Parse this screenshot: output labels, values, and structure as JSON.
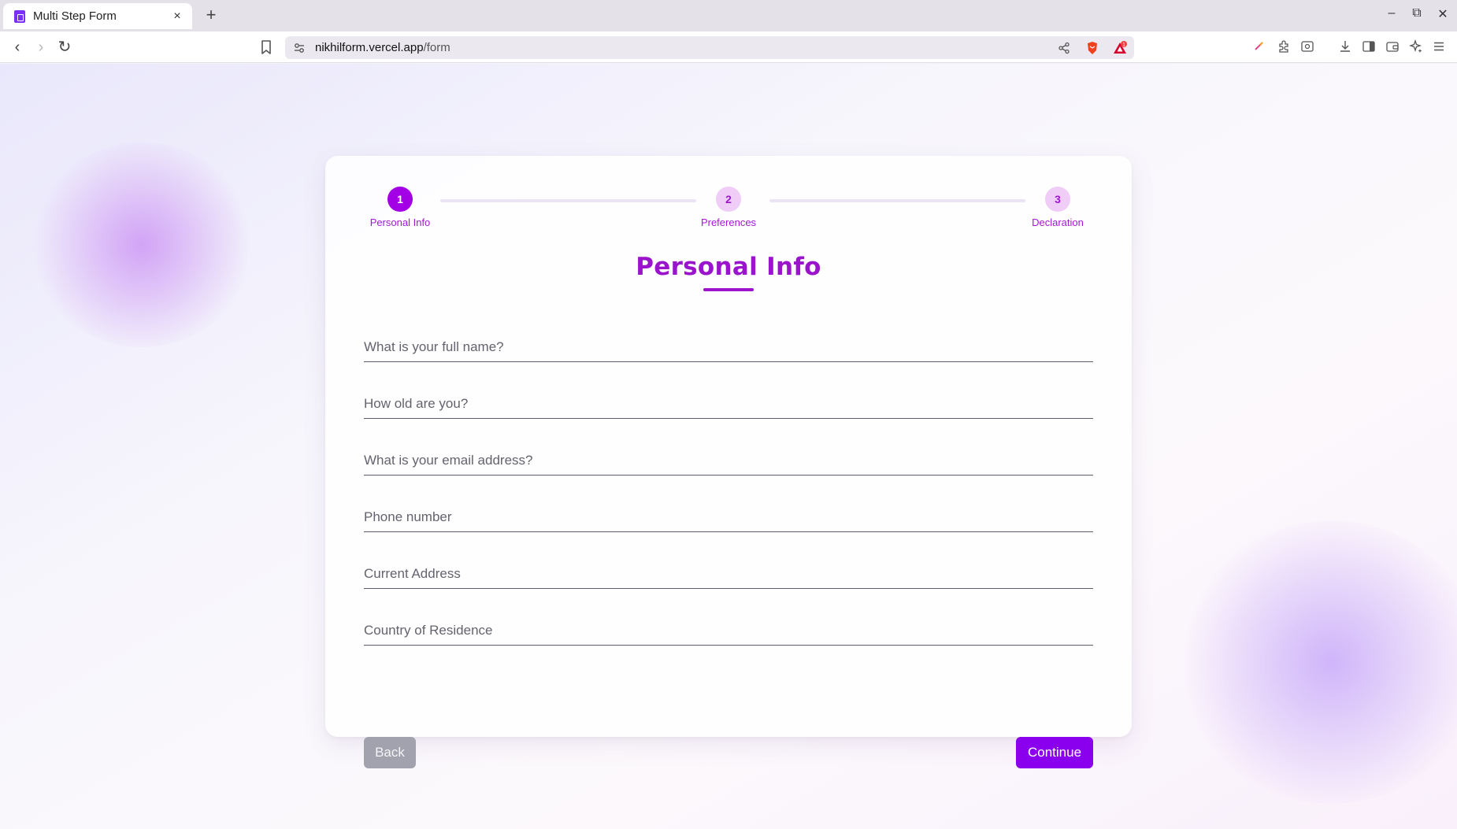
{
  "browser": {
    "tab_title": "Multi Step Form",
    "tab_close": "×",
    "new_tab": "+",
    "url_host": "nikhilform.vercel.app",
    "url_path": "/form",
    "window": {
      "minimize": "–",
      "maximize": "⧉",
      "close": "✕"
    },
    "nav": {
      "back": "‹",
      "forward": "›",
      "reload": "↻"
    },
    "brave_badge": "1"
  },
  "stepper": {
    "steps": [
      {
        "number": "1",
        "label": "Personal Info",
        "state": "active"
      },
      {
        "number": "2",
        "label": "Preferences",
        "state": "inactive"
      },
      {
        "number": "3",
        "label": "Declaration",
        "state": "inactive"
      }
    ]
  },
  "form": {
    "heading": "Personal Info",
    "fields": [
      {
        "placeholder": "What is your full name?",
        "value": ""
      },
      {
        "placeholder": "How old are you?",
        "value": ""
      },
      {
        "placeholder": "What is your email address?",
        "value": ""
      },
      {
        "placeholder": "Phone number",
        "value": ""
      },
      {
        "placeholder": "Current Address",
        "value": ""
      },
      {
        "placeholder": "Country of Residence",
        "value": ""
      }
    ],
    "back_label": "Back",
    "continue_label": "Continue"
  },
  "colors": {
    "accent": "#a300e6",
    "continue_button": "#8a00ee",
    "back_button": "#a2a2ae",
    "step_inactive": "#f0cdf7"
  }
}
